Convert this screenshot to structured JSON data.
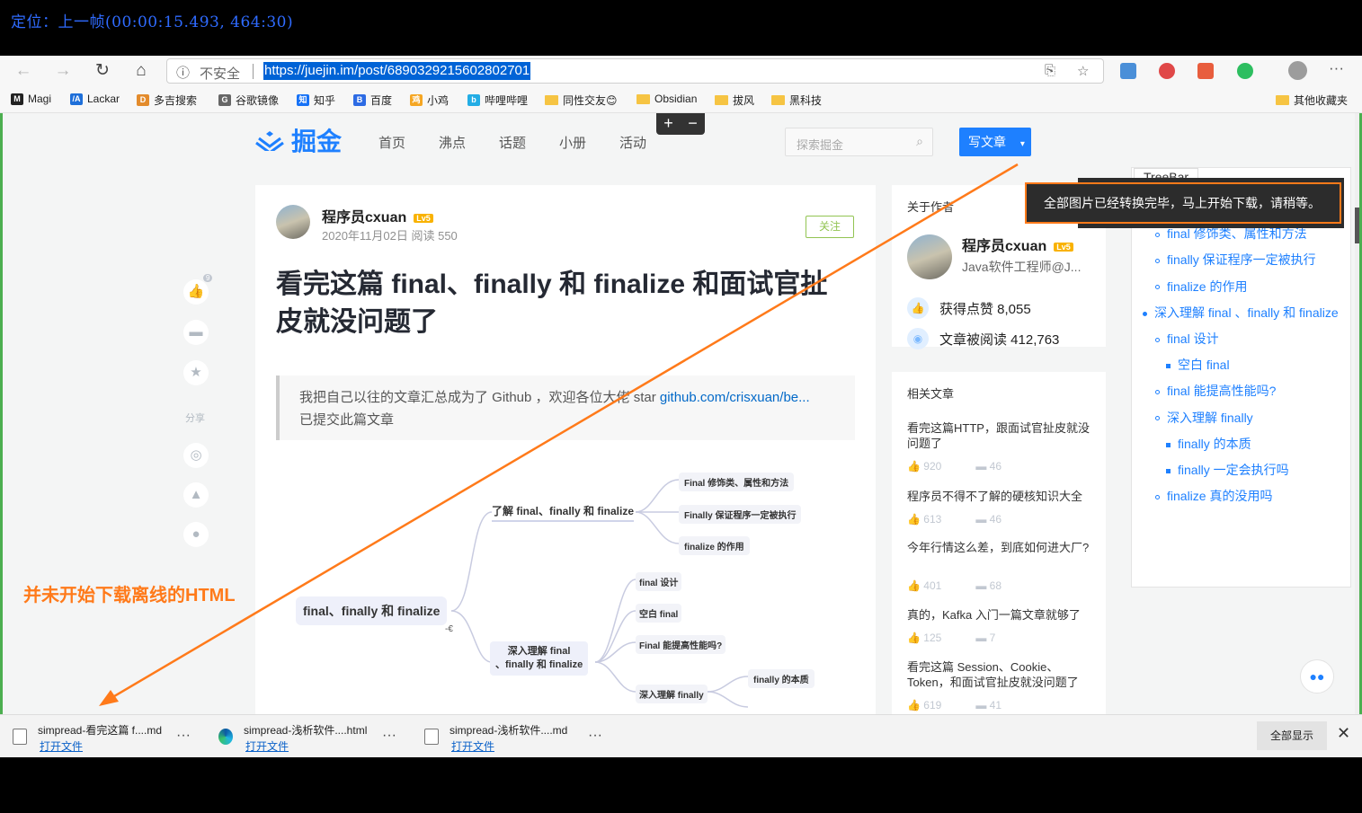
{
  "overlay": {
    "title": "定位：上一帧(00:00:15.493, 464:30)"
  },
  "toolbar": {
    "back_icon": "←",
    "forward_icon": "→",
    "refresh_icon": "↻",
    "home_icon": "⌂",
    "info_icon": "ⓘ",
    "insecure_label": "不安全",
    "url": "https://juejin.im/post/6890329215602802701",
    "reader_icon": "⎘",
    "star_icon": "☆",
    "more_icon": "···"
  },
  "bookmarks": [
    {
      "label": "Magi",
      "icon": "M",
      "color": "#222222"
    },
    {
      "label": "Lackar",
      "icon": "/A",
      "color": "#1e6fd9"
    },
    {
      "label": "多吉搜索",
      "icon": "D",
      "color": "#e38b2c"
    },
    {
      "label": "谷歌镜像",
      "icon": "G",
      "color": "#666666"
    },
    {
      "label": "知乎",
      "icon": "知",
      "color": "#1772f6"
    },
    {
      "label": "百度",
      "icon": "B",
      "color": "#2d6be4"
    },
    {
      "label": "小鸡",
      "icon": "鸡",
      "color": "#f5a623"
    },
    {
      "label": "哔哩哔哩",
      "icon": "b",
      "color": "#23ade5"
    },
    {
      "label": "同性交友😊",
      "icon": "folder",
      "color": "#f6c443"
    },
    {
      "label": "Obsidian",
      "icon": "folder",
      "color": "#f6c443"
    },
    {
      "label": "拔风",
      "icon": "folder",
      "color": "#f6c443"
    },
    {
      "label": "黑科技",
      "icon": "folder",
      "color": "#f6c443"
    },
    {
      "label": "其他收藏夹",
      "icon": "folder",
      "color": "#f6c443"
    }
  ],
  "zoom": {
    "plus": "+",
    "minus": "−"
  },
  "juejin": {
    "logo": "掘金",
    "nav": [
      "首页",
      "沸点",
      "话题",
      "小册",
      "活动"
    ],
    "search_placeholder": "探索掘金",
    "search_icon": "⌕",
    "write_label": "写文章",
    "write_dropdown": "▾"
  },
  "tooltip": {
    "text": "全部图片已经转换完毕，马上开始下载，请稍等。"
  },
  "article": {
    "author": "程序员cxuan",
    "level": "Lv5",
    "meta": "2020年11月02日   阅读 550",
    "follow": "关注",
    "title": "看完这篇 final、finally 和 finalize 和面试官扯皮就没问题了",
    "quote_text": "我把自己以往的文章汇总成为了 Github ，欢迎各位大佬 star ",
    "quote_link": "github.com/crisxuan/be...",
    "quote_line2": "已提交此篇文章"
  },
  "left_actions": {
    "like_icon": "👍",
    "like_count": "9",
    "comment_icon": "▬",
    "collect_icon": "★",
    "share_label": "分享",
    "weibo_icon": "◎",
    "qq_icon": "▲",
    "wechat_icon": "●"
  },
  "mindmap": {
    "root": "final、finally 和 finalize",
    "branch1": "了解 final、finally 和 finalize",
    "b1_items": [
      "Final 修饰类、属性和方法",
      "Finally 保证程序一定被执行",
      "finalize 的作用"
    ],
    "branch2_line1": "深入理解 final",
    "branch2_line2": "、finally 和 finalize",
    "b2_items": [
      "final 设计",
      "空白 final",
      "Final 能提高性能吗?",
      "深入理解 finally"
    ],
    "b2_sub": [
      "finally 的本质"
    ],
    "marker": "-€"
  },
  "sidebar": {
    "about_title": "关于作者",
    "author": "程序员cxuan",
    "level": "Lv5",
    "role": "Java软件工程师@J...",
    "likes_label": "获得点赞 8,055",
    "reads_label": "文章被阅读 412,763",
    "related_title": "相关文章",
    "related": [
      {
        "title": "看完这篇HTTP，跟面试官扯皮就没问题了",
        "likes": "920",
        "comments": "46"
      },
      {
        "title": "程序员不得不了解的硬核知识大全",
        "likes": "613",
        "comments": "46"
      },
      {
        "title": "今年行情这么差，到底如何进大厂?",
        "likes": "401",
        "comments": "68"
      },
      {
        "title": "真的，Kafka 入门一篇文章就够了",
        "likes": "125",
        "comments": "7"
      },
      {
        "title": "看完这篇 Session、Cookie、Token，和面试官扯皮就没问题了",
        "likes": "619",
        "comments": "41"
      }
    ]
  },
  "treebar": {
    "label": "TreeBar",
    "items": [
      {
        "text": "final、finally 和 finalize",
        "level": 1
      },
      {
        "text": "final 修饰类、属性和方法",
        "level": 2
      },
      {
        "text": "finally 保证程序一定被执行",
        "level": 2
      },
      {
        "text": "finalize 的作用",
        "level": 2
      },
      {
        "text": "深入理解 final 、finally 和 finalize",
        "level": 1
      },
      {
        "text": "final 设计",
        "level": 2
      },
      {
        "text": "空白 final",
        "level": 3
      },
      {
        "text": "final 能提高性能吗?",
        "level": 2
      },
      {
        "text": "深入理解 finally",
        "level": 2
      },
      {
        "text": "finally 的本质",
        "level": 3
      },
      {
        "text": "finally 一定会执行吗",
        "level": 3
      },
      {
        "text": "finalize 真的没用吗",
        "level": 2
      }
    ]
  },
  "annotation": {
    "text": "并未开始下载离线的HTML",
    "color": "#ff7a1a"
  },
  "chat": {
    "icon": "💬"
  },
  "downloads": {
    "items": [
      {
        "name": "simpread-看完这篇 f....md",
        "open": "打开文件",
        "type": "md"
      },
      {
        "name": "simpread-浅析软件....html",
        "open": "打开文件",
        "type": "edge"
      },
      {
        "name": "simpread-浅析软件....md",
        "open": "打开文件",
        "type": "md"
      }
    ],
    "more": "···",
    "show_all": "全部显示",
    "close": "✕"
  }
}
